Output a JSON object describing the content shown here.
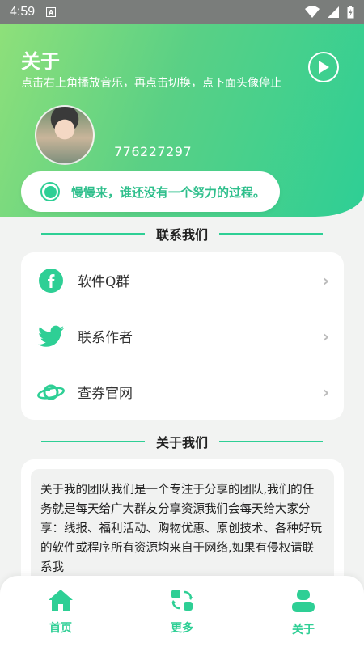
{
  "status_bar": {
    "time": "4:59",
    "notification_letter": "A"
  },
  "header": {
    "title": "关于",
    "subtitle": "点击右上角播放音乐，再点击切换，点下面头像停止",
    "user_id": "776227297",
    "motto": "慢慢来，谁还没有一个努力的过程。"
  },
  "contact": {
    "section_title": "联系我们",
    "items": [
      {
        "label": "软件Q群",
        "icon": "facebook-icon"
      },
      {
        "label": "联系作者",
        "icon": "twitter-icon"
      },
      {
        "label": "查券官网",
        "icon": "planet-icon"
      }
    ]
  },
  "about": {
    "section_title": "关于我们",
    "text": "关于我的团队我们是一个专注于分享的团队,我们的任务就是每天给广大群友分享资源我们会每天给大家分享：线报、福利活动、购物优惠、原创技术、各种好玩的软件或程序所有资源均来自于网络,如果有侵权请联系我"
  },
  "tabbar": {
    "tabs": [
      {
        "label": "首页",
        "icon": "home-icon"
      },
      {
        "label": "更多",
        "icon": "switch-icon"
      },
      {
        "label": "关于",
        "icon": "user-icon"
      }
    ]
  },
  "colors": {
    "accent": "#2ecf95",
    "gradient_start": "#8ee07a",
    "background": "#f2f3f2"
  }
}
